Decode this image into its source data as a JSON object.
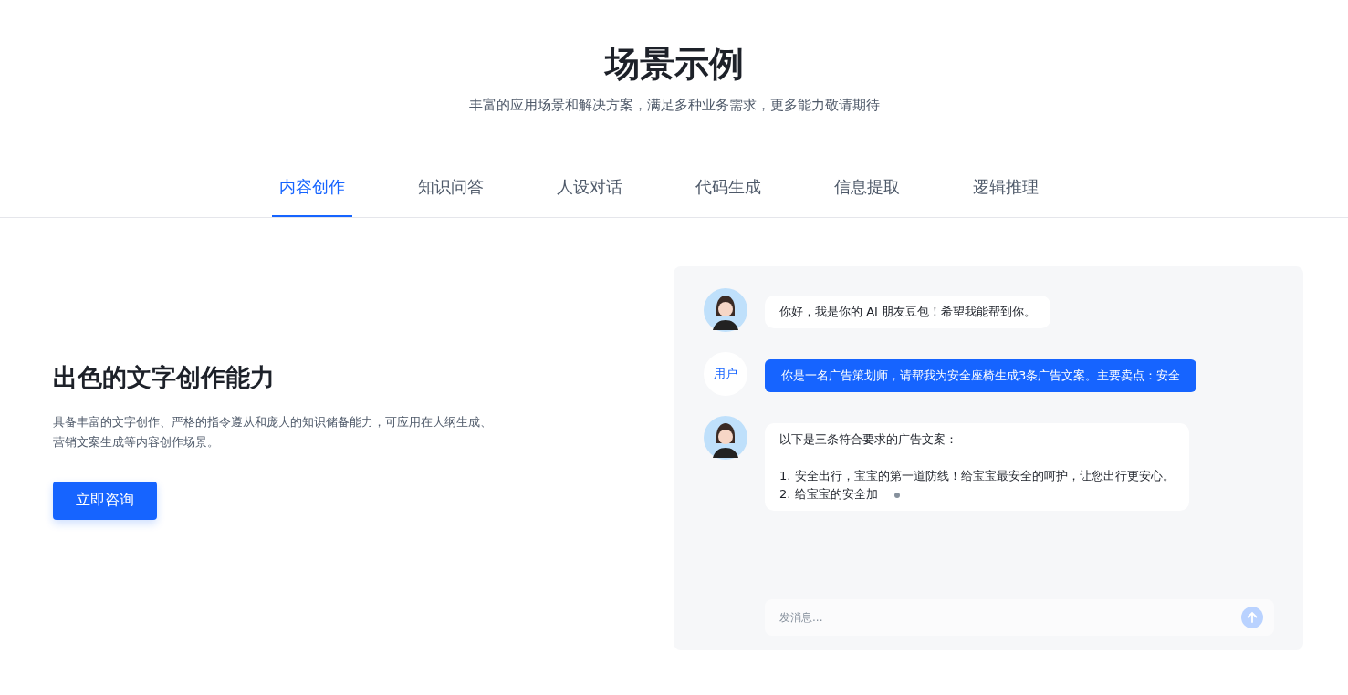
{
  "header": {
    "title": "场景示例",
    "subtitle": "丰富的应用场景和解决方案，满足多种业务需求，更多能力敬请期待"
  },
  "tabs": [
    {
      "label": "内容创作",
      "selected": true
    },
    {
      "label": "知识问答",
      "selected": false
    },
    {
      "label": "人设对话",
      "selected": false
    },
    {
      "label": "代码生成",
      "selected": false
    },
    {
      "label": "信息提取",
      "selected": false
    },
    {
      "label": "逻辑推理",
      "selected": false
    }
  ],
  "feature": {
    "heading": "出色的文字创作能力",
    "description": "具备丰富的文字创作、严格的指令遵从和庞大的知识储备能力，可应用在大纲生成、营销文案生成等内容创作场景。",
    "button": "立即咨询"
  },
  "chat": {
    "messages": [
      {
        "kind": "bot",
        "intro": "你好，我是你的 AI 朋友豆包！希望我能帮到你。",
        "typing": false
      },
      {
        "kind": "user",
        "avatar_label": "用户",
        "text": "你是一名广告策划师，请帮我为安全座椅生成3条广告文案。主要卖点：安全"
      },
      {
        "kind": "bot",
        "intro": "以下是三条符合要求的广告文案：",
        "items": [
          "1. 安全出行，宝宝的第一道防线！给宝宝最安全的呵护，让您出行更安心。",
          "2. 给宝宝的安全加"
        ],
        "typing": true
      }
    ],
    "input": {
      "placeholder": "发消息...",
      "send_disabled": true
    }
  }
}
